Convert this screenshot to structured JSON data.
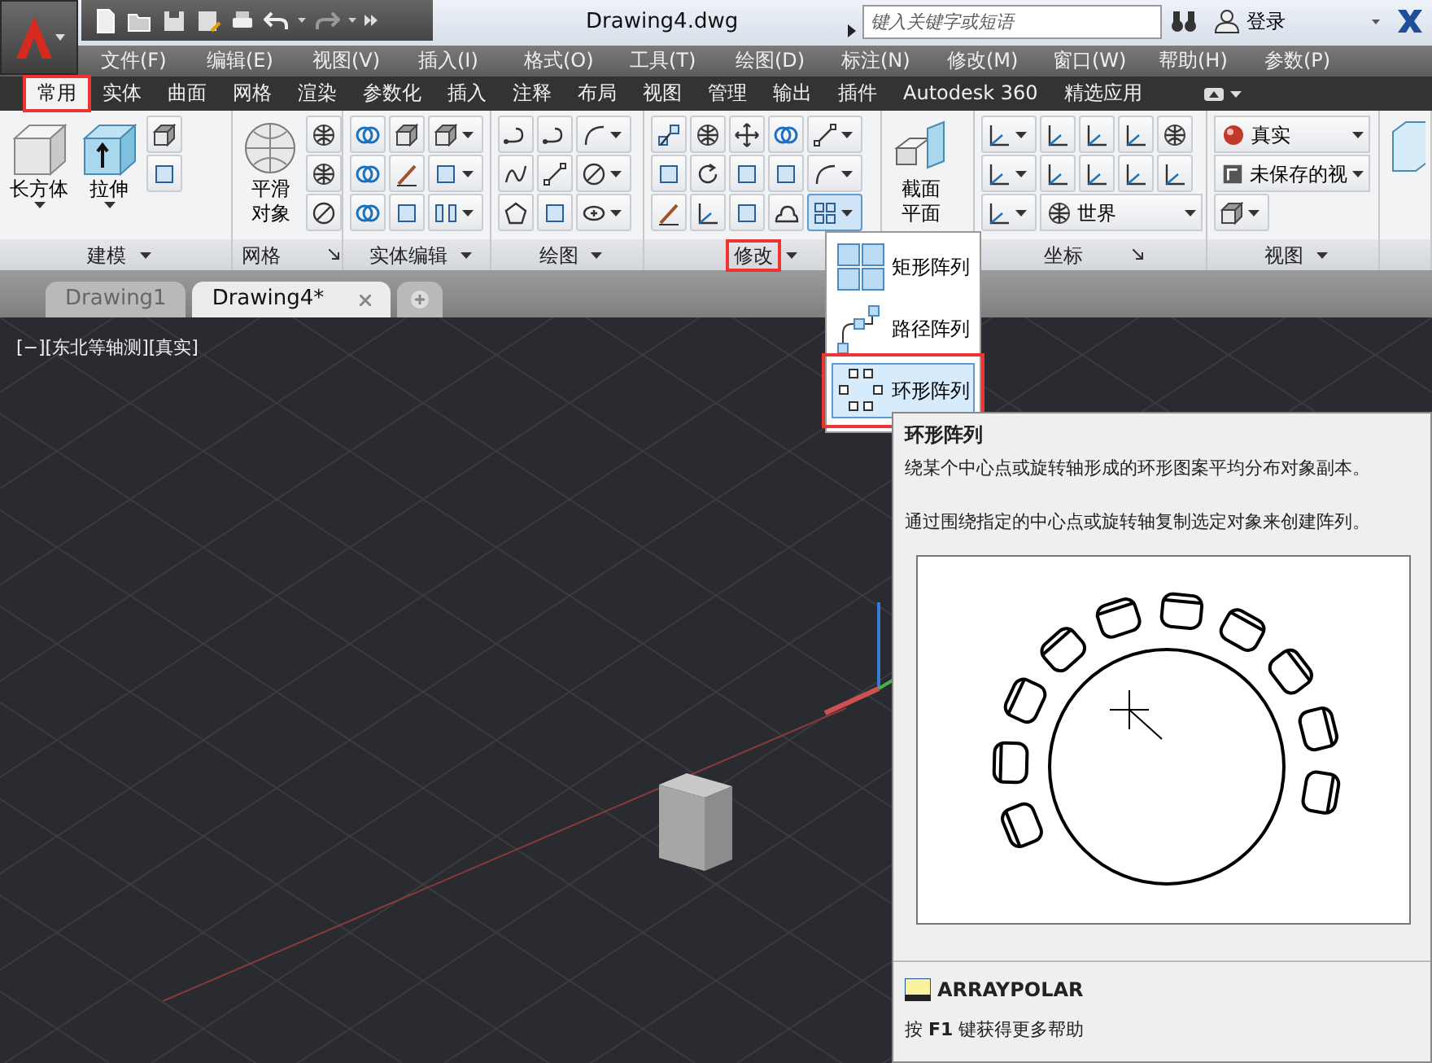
{
  "title_bar": {
    "title": "Drawing4.dwg",
    "search": {
      "placeholder": "键入关键字或短语"
    },
    "sign_in": "登录"
  },
  "menu_bar": [
    "文件(F)",
    "编辑(E)",
    "视图(V)",
    "插入(I)",
    "格式(O)",
    "工具(T)",
    "绘图(D)",
    "标注(N)",
    "修改(M)",
    "窗口(W)",
    "帮助(H)",
    "参数(P)"
  ],
  "ribbon_tabs": [
    {
      "label": "常用",
      "selected": true,
      "highlighted": true
    },
    {
      "label": "实体",
      "selected": false,
      "highlighted": false
    },
    {
      "label": "曲面",
      "selected": false,
      "highlighted": false
    },
    {
      "label": "网格",
      "selected": false,
      "highlighted": false
    },
    {
      "label": "渲染",
      "selected": false,
      "highlighted": false
    },
    {
      "label": "参数化",
      "selected": false,
      "highlighted": false
    },
    {
      "label": "插入",
      "selected": false,
      "highlighted": false
    },
    {
      "label": "注释",
      "selected": false,
      "highlighted": false
    },
    {
      "label": "布局",
      "selected": false,
      "highlighted": false
    },
    {
      "label": "视图",
      "selected": false,
      "highlighted": false
    },
    {
      "label": "管理",
      "selected": false,
      "highlighted": false
    },
    {
      "label": "输出",
      "selected": false,
      "highlighted": false
    },
    {
      "label": "插件",
      "selected": false,
      "highlighted": false
    },
    {
      "label": "Autodesk 360",
      "selected": false,
      "highlighted": false
    },
    {
      "label": "精选应用",
      "selected": false,
      "highlighted": false
    }
  ],
  "ribbon_panels": [
    {
      "title": "建模",
      "kind": "menu",
      "highlighted": false,
      "buttons": [
        {
          "label": [
            "长方体"
          ],
          "dropdown": true
        },
        {
          "label": [
            "拉伸"
          ],
          "dropdown": true
        }
      ]
    },
    {
      "title": "网格",
      "kind": "launcher",
      "highlighted": false,
      "buttons": [
        {
          "label": [
            "平滑",
            "对象"
          ],
          "dropdown": false
        }
      ]
    },
    {
      "title": "实体编辑",
      "kind": "menu",
      "highlighted": false
    },
    {
      "title": "绘图",
      "kind": "menu",
      "highlighted": false
    },
    {
      "title": "修改",
      "kind": "menu",
      "highlighted": true
    },
    {
      "buttons": [
        {
          "label": [
            "截面",
            "平面"
          ],
          "dropdown": false
        }
      ]
    },
    {
      "title": "坐标",
      "kind": "launcher",
      "highlighted": false,
      "dropdowns": [
        "世界"
      ]
    },
    {
      "title": "视图",
      "kind": "menu",
      "highlighted": false,
      "dropdowns": [
        "真实",
        "未保存的视"
      ]
    }
  ],
  "document_tabs": [
    {
      "label": "Drawing1",
      "selected": false
    },
    {
      "label": "Drawing4*",
      "selected": true
    }
  ],
  "viewport": {
    "label": "[−][东北等轴测][真实]"
  },
  "array_menu": [
    {
      "label": "矩形阵列",
      "selected": false,
      "highlighted": false
    },
    {
      "label": "路径阵列",
      "selected": false,
      "highlighted": false
    },
    {
      "label": "环形阵列",
      "selected": true,
      "highlighted": true
    }
  ],
  "tooltip": {
    "title": "环形阵列",
    "description": "绕某个中心点或旋转轴形成的环形图案平均分布对象副本。",
    "detail": "通过围绕指定的中心点或旋转轴复制选定对象来创建阵列。",
    "command": "ARRAYPOLAR",
    "help": "按 **F1** 键获得更多帮助"
  }
}
